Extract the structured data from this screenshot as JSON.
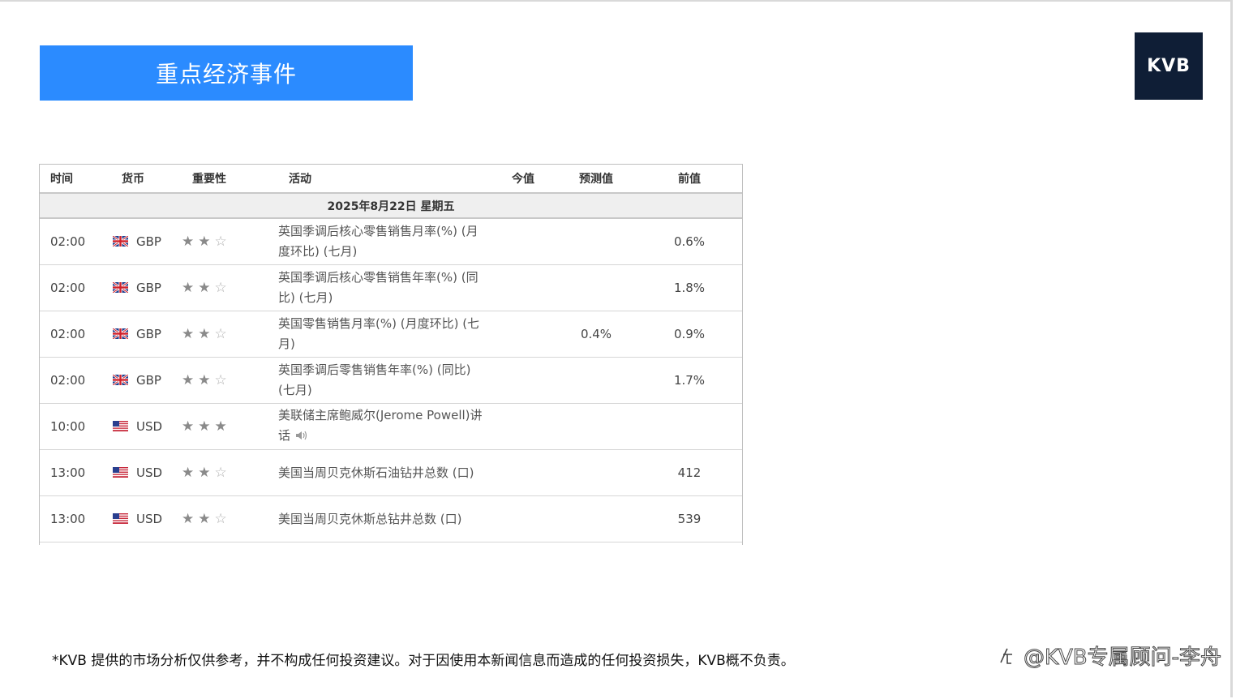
{
  "header": {
    "title": "重点经济事件",
    "logo_text": "KVB"
  },
  "table": {
    "columns": {
      "time": "时间",
      "currency": "货币",
      "importance": "重要性",
      "event": "活动",
      "actual": "今值",
      "forecast": "预测值",
      "previous": "前值"
    },
    "date_label": "2025年8月22日  星期五",
    "rows": [
      {
        "time": "02:00",
        "flag": "uk-flag-icon",
        "currency": "GBP",
        "stars": 2,
        "event": "英国季调后核心零售销售月率(%) (月度环比) (七月)",
        "actual": "",
        "forecast": "",
        "previous": "0.6%"
      },
      {
        "time": "02:00",
        "flag": "uk-flag-icon",
        "currency": "GBP",
        "stars": 2,
        "event": "英国季调后核心零售销售年率(%) (同比) (七月)",
        "actual": "",
        "forecast": "",
        "previous": "1.8%"
      },
      {
        "time": "02:00",
        "flag": "uk-flag-icon",
        "currency": "GBP",
        "stars": 2,
        "event": "英国零售销售月率(%) (月度环比) (七月)",
        "actual": "",
        "forecast": "0.4%",
        "previous": "0.9%"
      },
      {
        "time": "02:00",
        "flag": "uk-flag-icon",
        "currency": "GBP",
        "stars": 2,
        "event": "英国季调后零售销售年率(%) (同比) (七月)",
        "actual": "",
        "forecast": "",
        "previous": "1.7%"
      },
      {
        "time": "10:00",
        "flag": "us-flag-icon",
        "currency": "USD",
        "stars": 3,
        "event": "美联储主席鲍威尔(Jerome Powell)讲话",
        "speaker": true,
        "actual": "",
        "forecast": "",
        "previous": ""
      },
      {
        "time": "13:00",
        "flag": "us-flag-icon",
        "currency": "USD",
        "stars": 2,
        "event": "美国当周贝克休斯石油钻井总数 (口)",
        "actual": "",
        "forecast": "",
        "previous": "412"
      },
      {
        "time": "13:00",
        "flag": "us-flag-icon",
        "currency": "USD",
        "stars": 2,
        "event": "美国当周贝克休斯总钻井总数 (口)",
        "actual": "",
        "forecast": "",
        "previous": "539"
      }
    ]
  },
  "footer": {
    "disclaimer": "*KVB 提供的市场分析仅供参考，并不构成任何投资建议。对于因使用本新闻信息而造成的任何投资损失，KVB概不负责。",
    "watermark": "@KVB专属顾问-李舟"
  }
}
